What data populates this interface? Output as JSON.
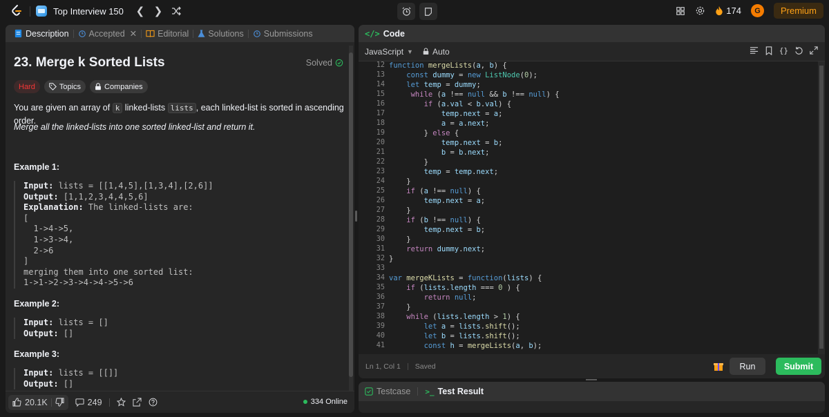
{
  "topbar": {
    "study_plan_title": "Top Interview 150",
    "streak_count": "174",
    "avatar_letter": "G",
    "premium_label": "Premium"
  },
  "left_tabs": [
    {
      "label": "Description",
      "active": true
    },
    {
      "label": "Accepted",
      "active": false
    },
    {
      "label": "Editorial",
      "active": false
    },
    {
      "label": "Solutions",
      "active": false
    },
    {
      "label": "Submissions",
      "active": false
    }
  ],
  "problem": {
    "title": "23. Merge k Sorted Lists",
    "status": "Solved",
    "difficulty": "Hard",
    "topics_label": "Topics",
    "companies_label": "Companies",
    "desc_p1_a": "You are given an array of ",
    "desc_p1_code1": "k",
    "desc_p1_b": " linked-lists ",
    "desc_p1_code2": "lists",
    "desc_p1_c": ", each linked-list is sorted in ascending order.",
    "desc_p2": "Merge all the linked-lists into one sorted linked-list and return it.",
    "example1_title": "Example 1:",
    "example1_input_label": "Input:",
    "example1_input": " lists = [[1,4,5],[1,3,4],[2,6]]",
    "example1_output_label": "Output:",
    "example1_output": " [1,1,2,3,4,4,5,6]",
    "example1_expl_label": "Explanation:",
    "example1_expl": " The linked-lists are:",
    "example1_rest": "[\n  1->4->5,\n  1->3->4,\n  2->6\n]\nmerging them into one sorted list:\n1->1->2->3->4->4->5->6",
    "example2_title": "Example 2:",
    "example2_input_label": "Input:",
    "example2_input": " lists = []",
    "example2_output_label": "Output:",
    "example2_output": " []",
    "example3_title": "Example 3:",
    "example3_input_label": "Input:",
    "example3_input": " lists = [[]]",
    "example3_output_label": "Output:",
    "example3_output": " []"
  },
  "left_footer": {
    "likes": "20.1K",
    "comments": "249",
    "online": "334 Online"
  },
  "code_panel": {
    "tab_label": "Code",
    "language": "JavaScript",
    "mode": "Auto",
    "status_position": "Ln 1, Col 1",
    "status_saved": "Saved",
    "run_label": "Run",
    "submit_label": "Submit"
  },
  "code_lines": [
    {
      "n": "12",
      "html": "<span class=\"kw\">function</span> <span class=\"fn\">mergeLists</span>(<span class=\"vr\">a</span>, <span class=\"vr\">b</span>) {"
    },
    {
      "n": "13",
      "html": "    <span class=\"kw\">const</span> <span class=\"vr\">dummy</span> = <span class=\"kw\">new</span> <span class=\"cls\">ListNode</span>(<span class=\"nm\">0</span>);"
    },
    {
      "n": "14",
      "html": "    <span class=\"kw\">let</span> <span class=\"vr\">temp</span> = <span class=\"vr\">dummy</span>;"
    },
    {
      "n": "15",
      "html": "     <span class=\"kw2\">while</span> (<span class=\"vr\">a</span> !== <span class=\"kw\">null</span> &amp;&amp; <span class=\"vr\">b</span> !== <span class=\"kw\">null</span>) {"
    },
    {
      "n": "16",
      "html": "        <span class=\"kw2\">if</span> (<span class=\"vr\">a</span>.<span class=\"vr\">val</span> &lt; <span class=\"vr\">b</span>.<span class=\"vr\">val</span>) {"
    },
    {
      "n": "17",
      "html": "            <span class=\"vr\">temp</span>.<span class=\"vr\">next</span> = <span class=\"vr\">a</span>;"
    },
    {
      "n": "18",
      "html": "            <span class=\"vr\">a</span> = <span class=\"vr\">a</span>.<span class=\"vr\">next</span>;"
    },
    {
      "n": "19",
      "html": "        } <span class=\"kw2\">else</span> {"
    },
    {
      "n": "20",
      "html": "            <span class=\"vr\">temp</span>.<span class=\"vr\">next</span> = <span class=\"vr\">b</span>;"
    },
    {
      "n": "21",
      "html": "            <span class=\"vr\">b</span> = <span class=\"vr\">b</span>.<span class=\"vr\">next</span>;"
    },
    {
      "n": "22",
      "html": "        }"
    },
    {
      "n": "23",
      "html": "        <span class=\"vr\">temp</span> = <span class=\"vr\">temp</span>.<span class=\"vr\">next</span>;"
    },
    {
      "n": "24",
      "html": "    }"
    },
    {
      "n": "25",
      "html": "    <span class=\"kw2\">if</span> (<span class=\"vr\">a</span> !== <span class=\"kw\">null</span>) {"
    },
    {
      "n": "26",
      "html": "        <span class=\"vr\">temp</span>.<span class=\"vr\">next</span> = <span class=\"vr\">a</span>;"
    },
    {
      "n": "27",
      "html": "    }"
    },
    {
      "n": "28",
      "html": "    <span class=\"kw2\">if</span> (<span class=\"vr\">b</span> !== <span class=\"kw\">null</span>) {"
    },
    {
      "n": "29",
      "html": "        <span class=\"vr\">temp</span>.<span class=\"vr\">next</span> = <span class=\"vr\">b</span>;"
    },
    {
      "n": "30",
      "html": "    }"
    },
    {
      "n": "31",
      "html": "    <span class=\"kw2\">return</span> <span class=\"vr\">dummy</span>.<span class=\"vr\">next</span>;"
    },
    {
      "n": "32",
      "html": "}"
    },
    {
      "n": "33",
      "html": ""
    },
    {
      "n": "34",
      "html": "<span class=\"kw\">var</span> <span class=\"fn\">mergeKLists</span> = <span class=\"kw\">function</span>(<span class=\"vr\">lists</span>) {"
    },
    {
      "n": "35",
      "html": "    <span class=\"kw2\">if</span> (<span class=\"vr\">lists</span>.<span class=\"vr\">length</span> === <span class=\"nm\">0</span> ) {"
    },
    {
      "n": "36",
      "html": "        <span class=\"kw2\">return</span> <span class=\"kw\">null</span>;"
    },
    {
      "n": "37",
      "html": "    }"
    },
    {
      "n": "38",
      "html": "    <span class=\"kw2\">while</span> (<span class=\"vr\">lists</span>.<span class=\"vr\">length</span> &gt; <span class=\"nm\">1</span>) {"
    },
    {
      "n": "39",
      "html": "        <span class=\"kw\">let</span> <span class=\"vr\">a</span> = <span class=\"vr\">lists</span>.<span class=\"fn\">shift</span>();"
    },
    {
      "n": "40",
      "html": "        <span class=\"kw\">let</span> <span class=\"vr\">b</span> = <span class=\"vr\">lists</span>.<span class=\"fn\">shift</span>();"
    },
    {
      "n": "41",
      "html": "        <span class=\"kw\">const</span> <span class=\"vr\">h</span> = <span class=\"fn\">mergeLists</span>(<span class=\"vr\">a</span>, <span class=\"vr\">b</span>);"
    }
  ],
  "bottom_tabs": [
    {
      "label": "Testcase",
      "active": false
    },
    {
      "label": "Test Result",
      "active": true
    }
  ],
  "colors": {
    "accent_green": "#2cbb5d",
    "hard_red": "#f63636",
    "premium_orange": "#ffa116"
  }
}
